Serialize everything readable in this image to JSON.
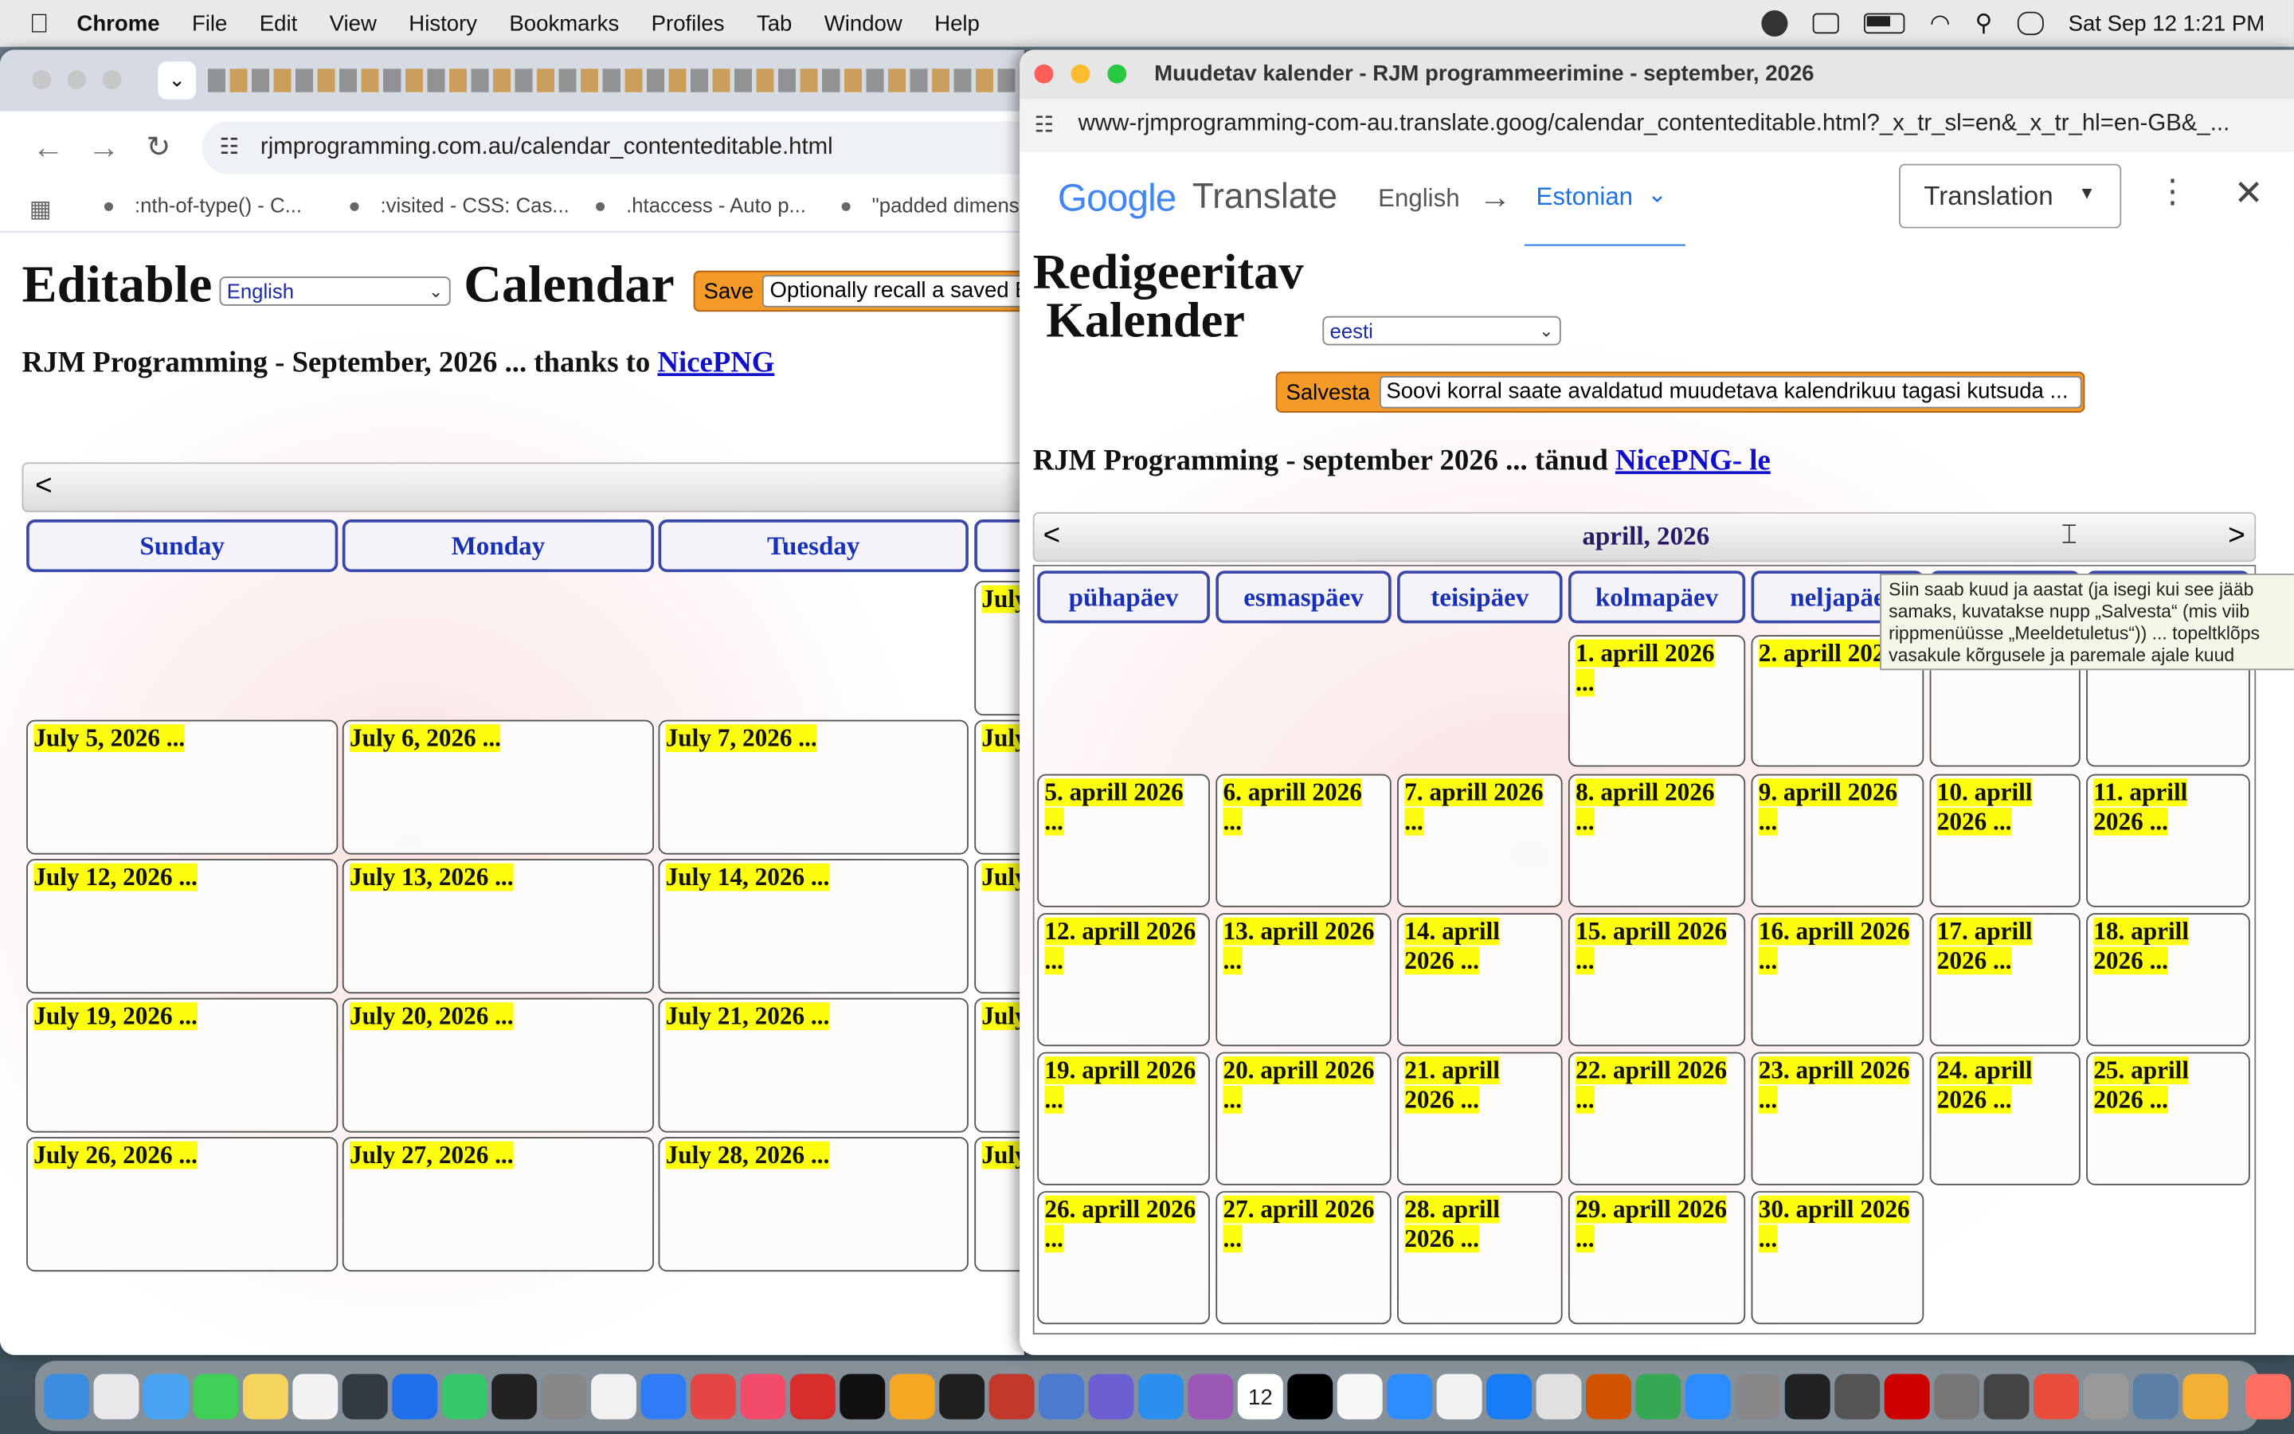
{
  "menubar": {
    "apple": "",
    "app": "Chrome",
    "items": [
      "File",
      "Edit",
      "View",
      "History",
      "Bookmarks",
      "Profiles",
      "Tab",
      "Window",
      "Help"
    ],
    "clock": "Sat Sep 12  1:21 PM"
  },
  "left_window": {
    "url": "rjmprogramming.com.au/calendar_contenteditable.html",
    "bookmarks": [
      ":nth-of-type() - C...",
      ":visited - CSS: Cas...",
      ".htaccess - Auto p...",
      "\"padded dimens"
    ],
    "heading_left": "Editable",
    "heading_right": "Calendar",
    "language": "English",
    "save_label": "Save",
    "recall_option": "Optionally recall a saved E",
    "subtitle": "RJM Programming - September, 2026 ... thanks to ",
    "subtitle_link": "NicePNG",
    "nav_prev": "<",
    "days": [
      "Sunday",
      "Monday",
      "Tuesday"
    ],
    "partial_col": [
      "July",
      "July",
      "July",
      "July",
      "July",
      "July"
    ],
    "rows": [
      [
        "",
        "",
        ""
      ],
      [
        "July 5, 2026 ...",
        "July 6, 2026 ...",
        "July 7, 2026 ..."
      ],
      [
        "July 12, 2026 ...",
        "July 13, 2026 ...",
        "July 14, 2026 ..."
      ],
      [
        "July 19, 2026 ...",
        "July 20, 2026 ...",
        "July 21, 2026 ..."
      ],
      [
        "July 26, 2026 ...",
        "July 27, 2026 ...",
        "July 28, 2026 ..."
      ]
    ]
  },
  "right_window": {
    "title": "Muudetav kalender - RJM programmeerimine - september, 2026",
    "url": "www-rjmprogramming-com-au.translate.goog/calendar_contenteditable.html?_x_tr_sl=en&_x_tr_hl=en-GB&_...",
    "gt_google": "Google",
    "gt_translate": "Translate",
    "gt_from": "English",
    "gt_arrow": "→",
    "gt_to": "Estonian",
    "gt_mode": "Translation",
    "heading1": "Redigeeritav",
    "heading2": "Kalender",
    "language": "eesti",
    "save_label": "Salvesta",
    "recall_option": "Soovi korral saate avaldatud muudetava kalendrikuu tagasi kutsuda ...",
    "subtitle": "RJM Programming - september 2026 ... tänud ",
    "subtitle_link": "NicePNG- le",
    "month": "aprill, 2026",
    "nav_prev": "<",
    "nav_next": ">",
    "days": [
      "pühapäev",
      "esmaspäev",
      "teisipäev",
      "kolmapäev",
      "neljapäe",
      "",
      ""
    ],
    "tooltip": "Siin saab kuud ja aastat (ja isegi kui see jääb samaks, kuvatakse nupp „Salvesta“ (mis viib rippmenüüsse „Meeldetuletus“)) ... topeltklõps vasakule kõrgusele ja paremale ajale kuud",
    "rows": [
      [
        "",
        "",
        "",
        "1. aprill 2026 ...",
        "2. aprill 202",
        "...",
        "..."
      ],
      [
        "5. aprill 2026 ...",
        "6. aprill 2026 ...",
        "7. aprill 2026 ...",
        "8. aprill 2026 ...",
        "9. aprill 2026 ...",
        "10. aprill 2026 ...",
        "11. aprill 2026 ..."
      ],
      [
        "12. aprill 2026 ...",
        "13. aprill 2026 ...",
        "14. aprill 2026 ...",
        "15. aprill 2026 ...",
        "16. aprill 2026 ...",
        "17. aprill 2026 ...",
        "18. aprill 2026 ..."
      ],
      [
        "19. aprill 2026 ...",
        "20. aprill 2026 ...",
        "21. aprill 2026 ...",
        "22. aprill 2026 ...",
        "23. aprill 2026 ...",
        "24. aprill 2026 ...",
        "25. aprill 2026 ..."
      ],
      [
        "26. aprill 2026 ...",
        "27. aprill 2026 ...",
        "28. aprill 2026 ...",
        "29. aprill 2026 ...",
        "30. aprill 2026 ...",
        "",
        ""
      ]
    ]
  },
  "dock": {
    "calendar_day": "12"
  },
  "colors": {
    "highlight": "#fdfd10",
    "save_orange": "#f39a28",
    "link_blue": "#1010cc",
    "header_blue": "#1830b8",
    "google_blue": "#1a73e8"
  }
}
